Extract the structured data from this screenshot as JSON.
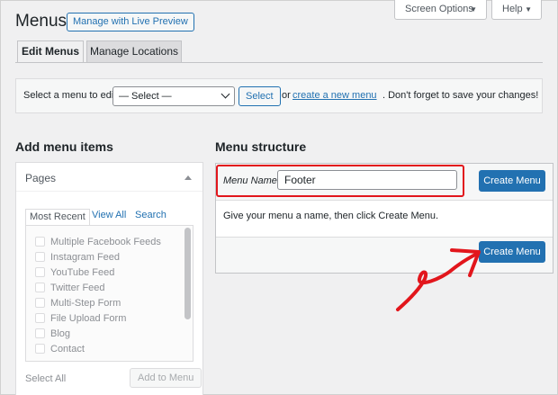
{
  "header": {
    "title": "Menus",
    "live_preview_label": "Manage with Live Preview",
    "screen_options_label": "Screen Options",
    "help_label": "Help"
  },
  "tabs": [
    {
      "label": "Edit Menus",
      "active": true
    },
    {
      "label": "Manage Locations",
      "active": false
    }
  ],
  "select_menu": {
    "label": "Select a menu to edit:",
    "selected": "— Select —",
    "button": "Select",
    "or": "or",
    "create_link": "create a new menu",
    "tail": ". Don't forget to save your changes!"
  },
  "add_items": {
    "heading": "Add menu items",
    "pages_title": "Pages",
    "tabs": [
      "Most Recent",
      "View All",
      "Search"
    ],
    "items": [
      "Multiple Facebook Feeds",
      "Instagram Feed",
      "YouTube Feed",
      "Twitter Feed",
      "Multi-Step Form",
      "File Upload Form",
      "Blog",
      "Contact"
    ],
    "select_all": "Select All",
    "add_button": "Add to Menu"
  },
  "menu_structure": {
    "heading": "Menu structure",
    "name_label": "Menu Name",
    "name_value": "Footer",
    "create_button": "Create Menu",
    "helper": "Give your menu a name, then click Create Menu."
  },
  "colors": {
    "accent": "#2271b1",
    "highlight": "#e2161c"
  }
}
